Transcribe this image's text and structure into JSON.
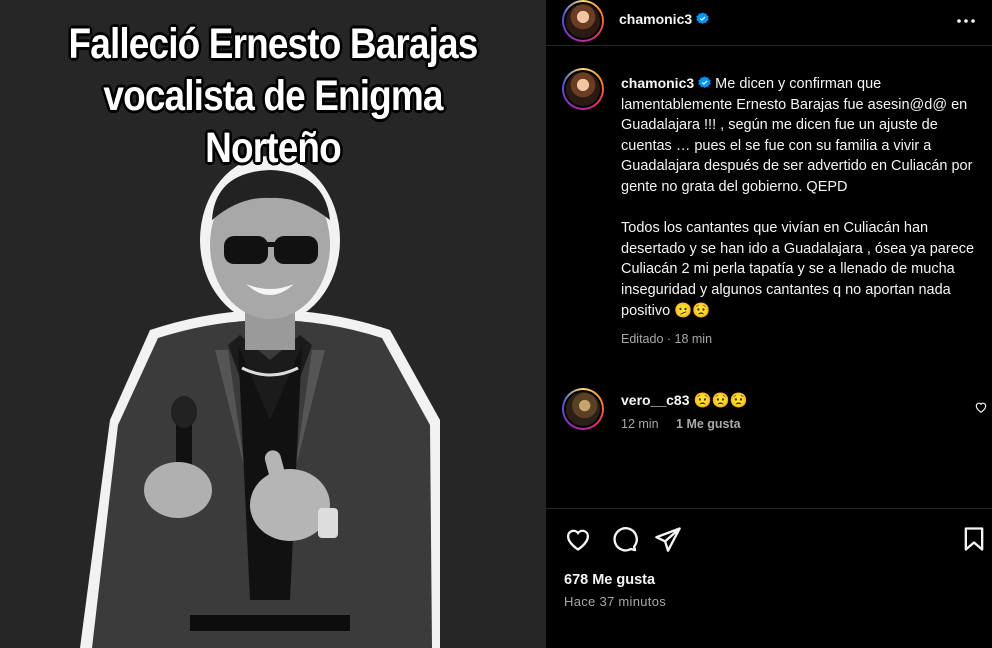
{
  "image": {
    "headline_line1": "Falleció Ernesto Barajas",
    "headline_line2": "vocalista de Enigma Norteño"
  },
  "header": {
    "username": "chamonic3",
    "verified_icon": "verified-badge-icon",
    "more_icon": "more-options-icon"
  },
  "caption": {
    "username": "chamonic3",
    "text": " Me dicen y confirman que lamentablemente Ernesto Barajas fue asesin@d@ en Guadalajara !!! , según me dicen fue un ajuste de cuentas … pues el se fue con su familia a vivir a Guadalajara después de ser advertido en Culiacán por gente no grata del gobierno. QEPD\n\nTodos los cantantes que vivían en Culiacán han desertado y se han ido a Guadalajara , ósea ya parece Culiacán 2 mi perla tapatía y se a llenado de mucha inseguridad y algunos cantantes q no aportan nada positivo 🫤😟",
    "meta": "Editado · 18 min"
  },
  "comments": [
    {
      "username": "vero__c83",
      "text": " 😟😟😟",
      "time": "12 min",
      "likes": "1 Me gusta"
    }
  ],
  "actions": {
    "like_icon": "heart-icon",
    "comment_icon": "comment-icon",
    "share_icon": "share-icon",
    "save_icon": "bookmark-icon"
  },
  "footer": {
    "likes": "678 Me gusta",
    "time": "Hace 37 minutos"
  },
  "colors": {
    "background": "#000000",
    "image_background": "#262626",
    "verified": "#0095f6",
    "muted_text": "#a8a8a8"
  }
}
